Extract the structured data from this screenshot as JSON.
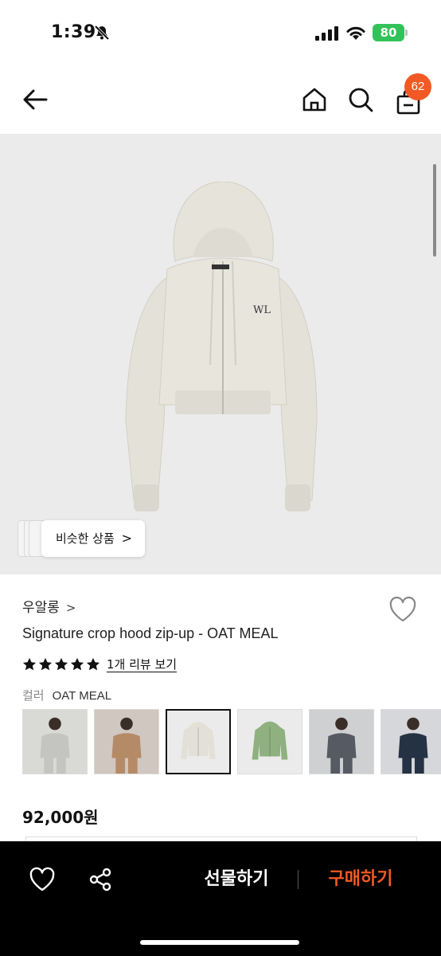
{
  "status_bar": {
    "time": "1:39",
    "battery": "80"
  },
  "header": {
    "cart_count": "62"
  },
  "image_overlay": {
    "similar_label": "비슷한 상품",
    "similar_chevron": ">"
  },
  "product": {
    "brand": "우알롱",
    "brand_chevron": ">",
    "title": "Signature crop hood zip-up - OAT MEAL",
    "rating": 5,
    "review_link": "1개 리뷰 보기",
    "color_label": "컬러",
    "color_value": "OAT MEAL",
    "price": "92,000원"
  },
  "swatches": [
    {
      "name": "grey-set-model",
      "bg": "#d9d9d6",
      "garment": "#c4c4c0",
      "selected": false
    },
    {
      "name": "brown-set-model",
      "bg": "#cfc7c0",
      "garment": "#b58a66",
      "selected": false
    },
    {
      "name": "oat-meal",
      "bg": "#ebebeb",
      "garment": "#e3e0d8",
      "selected": true
    },
    {
      "name": "green",
      "bg": "#ebebeb",
      "garment": "#8fb07f",
      "selected": false
    },
    {
      "name": "charcoal-model",
      "bg": "#cfd0d2",
      "garment": "#555a63",
      "selected": false
    },
    {
      "name": "navy-model",
      "bg": "#d6d7da",
      "garment": "#243244",
      "selected": false
    }
  ],
  "bottom_bar": {
    "gift_label": "선물하기",
    "buy_label": "구매하기"
  },
  "colors": {
    "accent": "#f15a24",
    "battery": "#33c25a",
    "bar": "#000000"
  }
}
